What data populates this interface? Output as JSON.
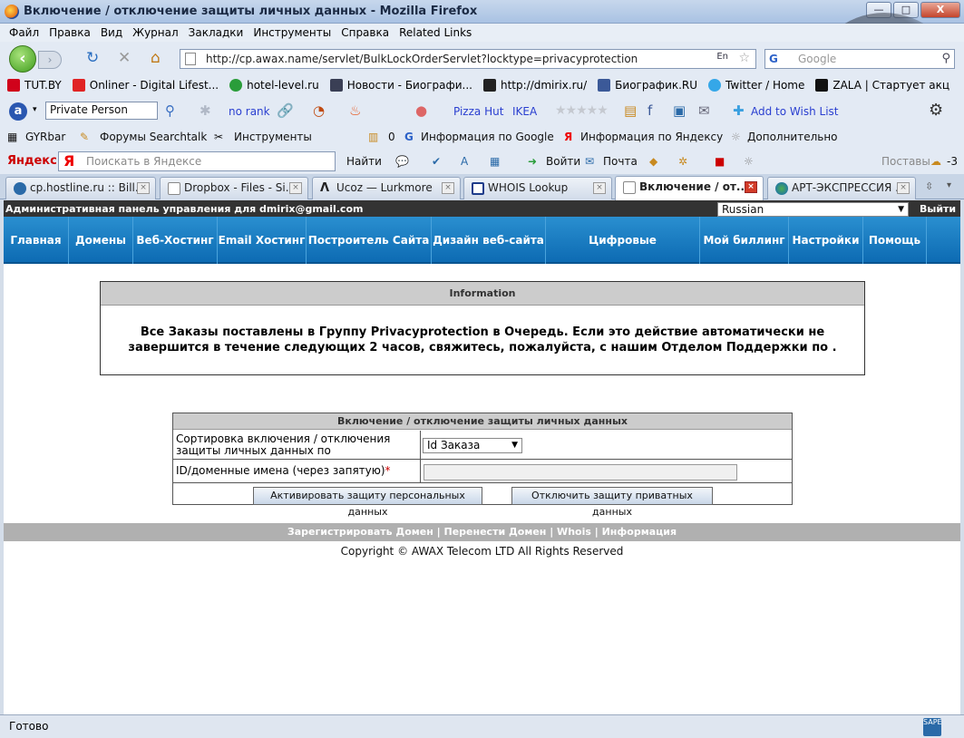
{
  "window": {
    "title": "Включение / отключение защиты личных данных - Mozilla Firefox",
    "buttons": {
      "minimize": "—",
      "maximize": "□",
      "close": "X"
    }
  },
  "menu": [
    "Файл",
    "Правка",
    "Вид",
    "Журнал",
    "Закладки",
    "Инструменты",
    "Справка",
    "Related Links"
  ],
  "nav": {
    "url": "http://cp.awax.name/servlet/BulkLockOrderServlet?locktype=privacyprotection",
    "lang_indicator": "En",
    "search_placeholder": "Google"
  },
  "bookmarks": [
    {
      "label": "TUT.BY",
      "color": "#d0021b"
    },
    {
      "label": "Onliner - Digital Lifest...",
      "color": "#e02424"
    },
    {
      "label": "hotel-level.ru",
      "color": "#2a9d3a"
    },
    {
      "label": "Новости - Биографи...",
      "color": "#3a3f55"
    },
    {
      "label": "http://dmirix.ru/",
      "color": "#222222"
    },
    {
      "label": "Биографик.RU",
      "color": "#3b5998"
    },
    {
      "label": "Twitter / Home",
      "color": "#35a7e8"
    },
    {
      "label": "ZALA | Стартует акц",
      "color": "#111111"
    }
  ],
  "alexa": {
    "input_value": "Private Person",
    "rank": "no rank",
    "pizza": "Pizza Hut",
    "ikea": "IKEA",
    "wishlist": "Add to Wish List"
  },
  "tools": {
    "gyrbar": "GYRbar",
    "forums": "Форумы Searchtalk",
    "instruments": "Инструменты",
    "count": "0",
    "google_info": "Информация по Google",
    "yandex_info": "Информация по Яндексу",
    "more": "Дополнительно"
  },
  "yandex": {
    "logo": "Яндекс",
    "search_placeholder": "Поискать в Яндексе",
    "find": "Найти",
    "login": "Войти",
    "mail": "Почта",
    "posts": "Поставы",
    "weather": "-3"
  },
  "tabs": [
    {
      "label": "cp.hostline.ru :: Bill...",
      "active": false
    },
    {
      "label": "Dropbox - Files - Si...",
      "active": false
    },
    {
      "label": "Ucoz — Lurkmore",
      "active": false
    },
    {
      "label": "WHOIS Lookup",
      "active": false
    },
    {
      "label": "Включение / от...",
      "active": true
    },
    {
      "label": "АРТ-ЭКСПРЕССИЯ ...",
      "active": false
    }
  ],
  "page": {
    "admin_label": "Административная панель управления для dmirix@gmail.com",
    "language": "Russian",
    "logout": "Выйти",
    "main_nav": [
      "Главная",
      "Домены",
      "Веб-Хостинг",
      "Email Хостинг",
      "Построитель Сайта",
      "Дизайн веб-сайта",
      "Цифровые сертификаты",
      "Мой биллинг",
      "Настройки",
      "Помощь"
    ],
    "info": {
      "header": "Information",
      "line1": "Все Заказы поставлены в Группу Privacyprotection в Очередь. Если это действие автоматически не",
      "line2": "завершится в течение следующих 2 часов, свяжитесь, пожалуйста, с нашим Отделом Поддержки по ."
    },
    "form": {
      "header": "Включение / отключение защиты личных данных",
      "sort_label_1": "Сортировка включения / отключения",
      "sort_label_2": "защиты личных данных по",
      "sort_value": "Id Заказа",
      "ids_label": "ID/доменные имена (через запятую)",
      "required_mark": "*",
      "ids_value": "",
      "activate_button": "Активировать защиту персональных данных",
      "disable_button": "Отключить защиту приватных данных"
    },
    "footer_links": "Зарегистрировать Домен | Перенести Домен | Whois | Информация",
    "copyright": "Copyright © AWAX Telecom LTD All Rights Reserved"
  },
  "status": {
    "text": "Готово",
    "icon_text": "SAPE"
  }
}
